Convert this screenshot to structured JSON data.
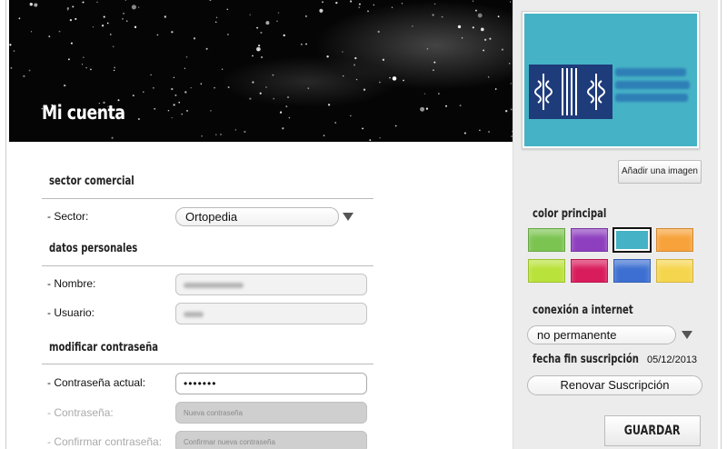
{
  "page": {
    "title": "Mi cuenta"
  },
  "form": {
    "commercial_sector": {
      "heading": "sector comercial",
      "sector_label": "- Sector:",
      "sector_value": "Ortopedia"
    },
    "personal_data": {
      "heading": "datos personales",
      "name_label": "- Nombre:",
      "user_label": "- Usuario:"
    },
    "change_password": {
      "heading": "modificar contraseña",
      "current_label": "- Contraseña actual:",
      "current_value": "•••••••",
      "new_label": "- Contraseña:",
      "new_placeholder": "Nueva contraseña",
      "confirm_label": "- Confirmar contraseña:",
      "confirm_placeholder": "Confirmar nueva contraseña"
    }
  },
  "sidebar": {
    "add_image_label": "Añadir una imagen",
    "main_color": {
      "heading": "color principal",
      "swatches": [
        "#7cc452",
        "#8e3fbf",
        "#45b2c6",
        "#f7a23a",
        "#b9e23a",
        "#d91c5c",
        "#3c6fd1",
        "#f6d54e"
      ],
      "selected": "#45b2c6"
    },
    "internet": {
      "heading": "conexión a internet",
      "value": "no permanente"
    },
    "subscription": {
      "heading": "fecha fin suscripción",
      "end_date": "05/12/2013",
      "renew_label": "Renovar Suscripción"
    },
    "save_label": "GUARDAR"
  }
}
